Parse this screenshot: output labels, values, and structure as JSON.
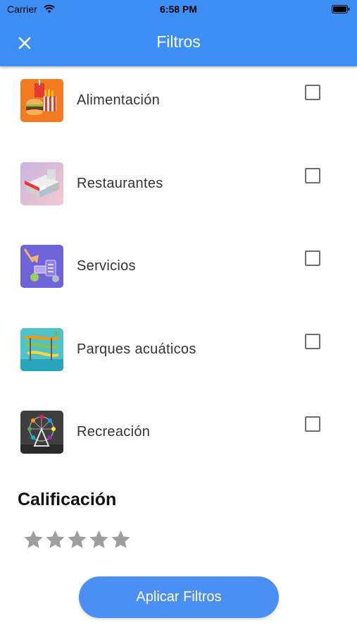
{
  "status": {
    "carrier": "Carrier",
    "time": "6:58 PM"
  },
  "header": {
    "title": "Filtros",
    "close_icon": "close-icon"
  },
  "categories": [
    {
      "label": "Alimentación",
      "icon": "food-thumbnail",
      "checked": false
    },
    {
      "label": "Restaurantes",
      "icon": "restaurant-thumbnail",
      "checked": false
    },
    {
      "label": "Servicios",
      "icon": "services-thumbnail",
      "checked": false
    },
    {
      "label": "Parques acuáticos",
      "icon": "waterpark-thumbnail",
      "checked": false
    },
    {
      "label": "Recreación",
      "icon": "recreation-thumbnail",
      "checked": false
    }
  ],
  "rating": {
    "title": "Calificación",
    "max": 5,
    "value": 0
  },
  "apply_button": {
    "label": "Aplicar Filtros"
  },
  "colors": {
    "primary": "#3d8ff5",
    "button": "#4b8ff4",
    "star": "#9e9e9e"
  }
}
